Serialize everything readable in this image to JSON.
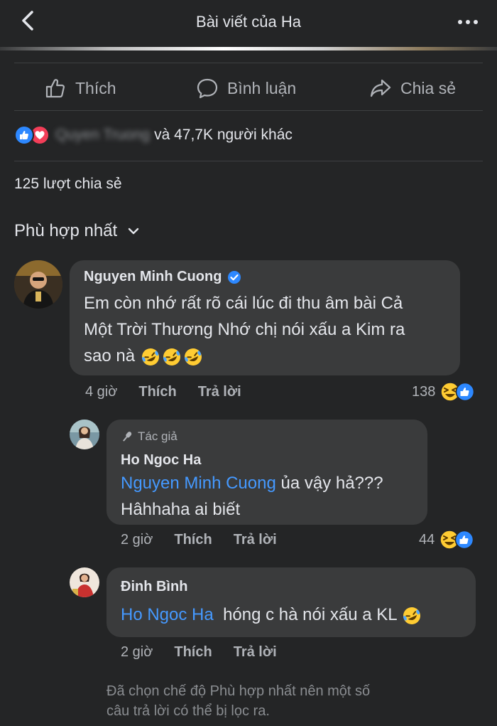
{
  "header": {
    "title": "Bài viết của Ha"
  },
  "actions": {
    "like": "Thích",
    "comment": "Bình luận",
    "share": "Chia sẻ"
  },
  "reactions": {
    "name": "Quyen Truong",
    "others": "và 47,7K người khác"
  },
  "shares": "125 lượt chia sẻ",
  "sort": {
    "label": "Phù hợp nhất"
  },
  "comments": [
    {
      "name": "Nguyen Minh Cuong",
      "verified": true,
      "text_line1": "Em còn nhớ rất rõ cái lúc đi thu âm bài Cả",
      "text_line2": "Một Trời Thương Nhớ chị nói xấu a Kim ra",
      "text_line3": "sao nà",
      "time": "4 giờ",
      "like": "Thích",
      "reply": "Trả lời",
      "reaction_count": "138"
    },
    {
      "badge": "Tác giả",
      "name": "Ho Ngoc Ha",
      "mention": "Nguyen Minh Cuong",
      "text_line1": " ủa vậy hả???",
      "text_line2": "Hâhhaha ai biết",
      "time": "2 giờ",
      "like": "Thích",
      "reply": "Trả lời",
      "reaction_count": "44"
    },
    {
      "name": "Đinh Bình",
      "mention": "Ho Ngoc Ha",
      "text": "  hóng c hà nói xấu a KL",
      "time": "2 giờ",
      "like": "Thích",
      "reply": "Trả lời"
    }
  ],
  "footer_note_line1": "Đã chọn chế độ Phù hợp nhất nên một số",
  "footer_note_line2": "câu trả lời có thể bị lọc ra.",
  "colors": {
    "background": "#242526",
    "bubble": "#3a3b3c",
    "link": "#4599ff",
    "like_blue": "#2d88ff",
    "love_red": "#f33e58"
  }
}
